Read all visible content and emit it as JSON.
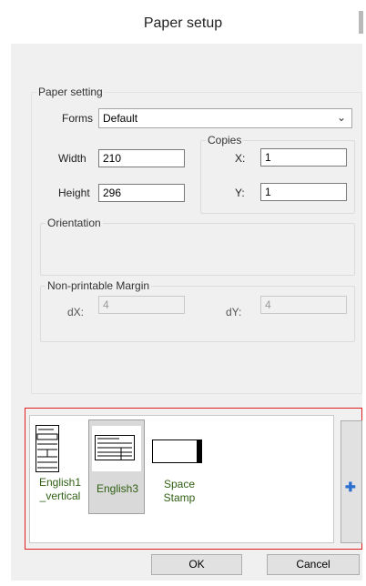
{
  "window": {
    "title": "Paper setup"
  },
  "paper_setting": {
    "group_label": "Paper setting",
    "forms_label": "Forms",
    "forms_value": "Default",
    "width_label": "Width",
    "width_value": "210",
    "height_label": "Height",
    "height_value": "296",
    "copies": {
      "group_label": "Copies",
      "x_label": "X:",
      "x_value": "1",
      "y_label": "Y:",
      "y_value": "1"
    },
    "orientation_label": "Orientation",
    "margin": {
      "group_label": "Non-printable Margin",
      "dx_label": "dX:",
      "dx_value": "4",
      "dy_label": "dY:",
      "dy_value": "4"
    }
  },
  "templates": {
    "items": [
      {
        "label": "English1\n_vertical",
        "icon": "vertical-form-thumbnail",
        "selected": false
      },
      {
        "label": "English3",
        "icon": "horizontal-form-thumbnail",
        "selected": true
      },
      {
        "label": "Space\nStamp",
        "icon": "stamp-thumbnail",
        "selected": false
      }
    ],
    "add_icon": "plus-icon",
    "label_color": "#2e5f12",
    "add_icon_color": "#2a6ecf",
    "highlight_color": "#e02020"
  },
  "buttons": {
    "ok_label": "OK",
    "cancel_label": "Cancel"
  }
}
